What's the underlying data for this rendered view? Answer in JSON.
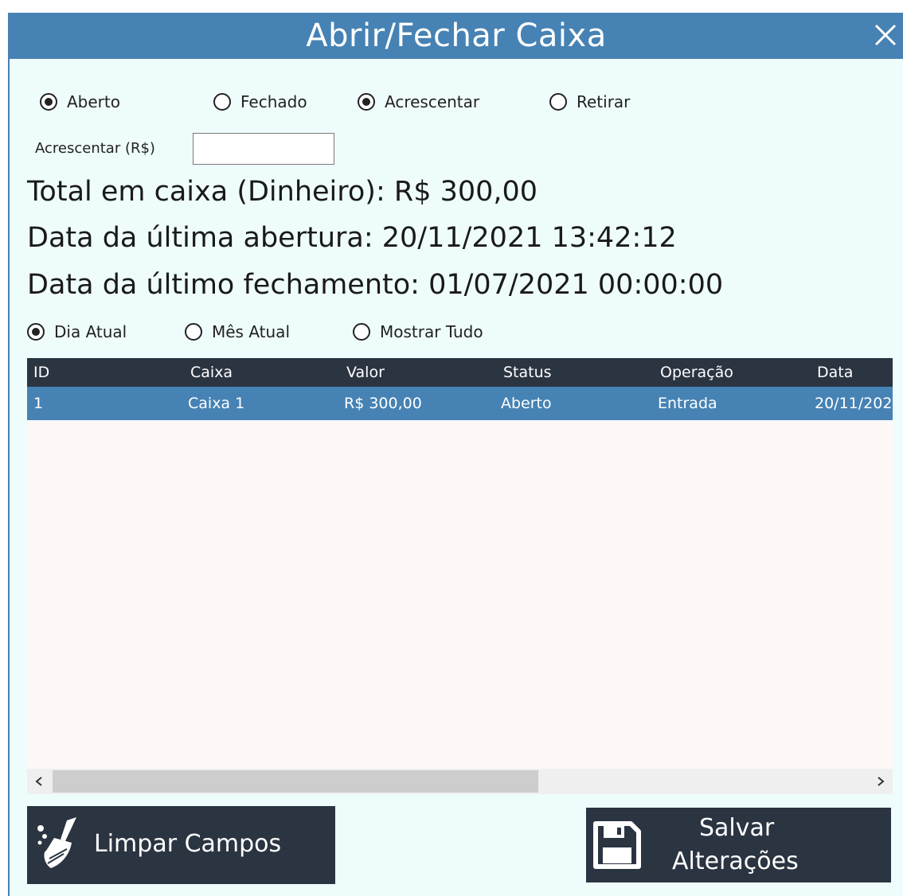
{
  "window": {
    "title": "Abrir/Fechar Caixa"
  },
  "status_radios": [
    {
      "label": "Aberto",
      "checked": true
    },
    {
      "label": "Fechado",
      "checked": false
    }
  ],
  "operation_radios": [
    {
      "label": "Acrescentar",
      "checked": true
    },
    {
      "label": "Retirar",
      "checked": false
    }
  ],
  "amount": {
    "label": "Acrescentar (R$)",
    "value": "",
    "placeholder": ""
  },
  "summary": {
    "total": "Total em caixa (Dinheiro): R$ 300,00",
    "last_open": "Data da última abertura: 20/11/2021 13:42:12",
    "last_close": "Data da último fechamento: 01/07/2021 00:00:00"
  },
  "filter_radios": [
    {
      "label": "Dia Atual",
      "checked": true
    },
    {
      "label": "Mês Atual",
      "checked": false
    },
    {
      "label": "Mostrar Tudo",
      "checked": false
    }
  ],
  "table": {
    "columns": [
      "ID",
      "Caixa",
      "Valor",
      "Status",
      "Operação",
      "Data"
    ],
    "rows": [
      [
        "1",
        "Caixa 1",
        "R$ 300,00",
        "Aberto",
        "Entrada",
        "20/11/202"
      ]
    ]
  },
  "buttons": {
    "clear": "Limpar Campos",
    "save_line1": "Salvar",
    "save_line2": "Alterações"
  },
  "colors": {
    "titlebar": "#4682b4",
    "background": "#effcfc",
    "header": "#2b3441",
    "selected_row": "#4682b4",
    "button": "#2b3441"
  },
  "icons": {
    "close": "close-icon",
    "broom": "broom-icon",
    "save": "floppy-disk-icon",
    "scroll_left": "chevron-left-icon",
    "scroll_right": "chevron-right-icon"
  }
}
